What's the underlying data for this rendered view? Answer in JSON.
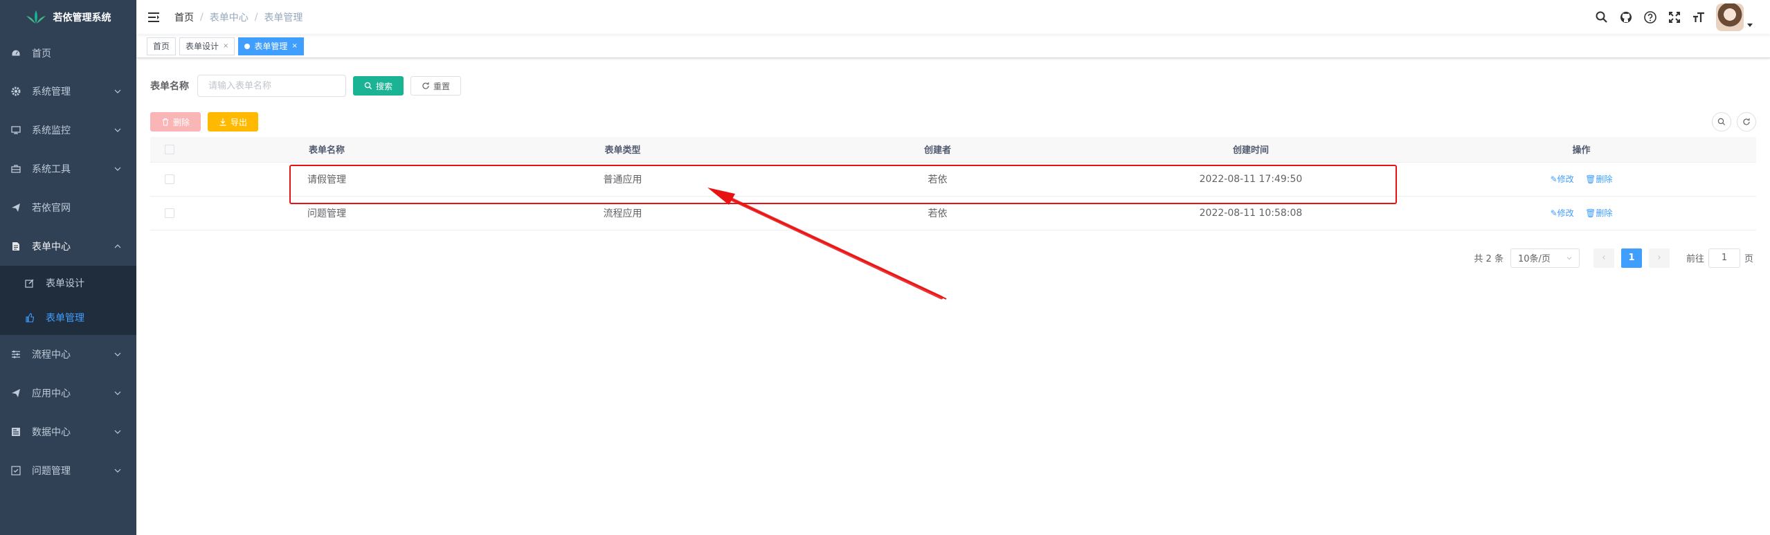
{
  "app": {
    "title": "若依管理系统"
  },
  "sidebar": {
    "items": [
      {
        "label": "首页",
        "icon": "dashboard-icon"
      },
      {
        "label": "系统管理",
        "icon": "gear-icon"
      },
      {
        "label": "系统监控",
        "icon": "monitor-icon"
      },
      {
        "label": "系统工具",
        "icon": "toolbox-icon"
      },
      {
        "label": "若依官网",
        "icon": "send-icon"
      },
      {
        "label": "表单中心",
        "icon": "form-icon"
      },
      {
        "label": "流程中心",
        "icon": "sliders-icon"
      },
      {
        "label": "应用中心",
        "icon": "send-icon"
      },
      {
        "label": "数据中心",
        "icon": "chart-icon"
      },
      {
        "label": "问题管理",
        "icon": "checkbox-icon"
      }
    ],
    "submenu": [
      {
        "label": "表单设计",
        "icon": "edit-icon"
      },
      {
        "label": "表单管理",
        "icon": "thumb-icon"
      }
    ]
  },
  "navbar": {
    "breadcrumb": [
      "首页",
      "表单中心",
      "表单管理"
    ],
    "separator": "/"
  },
  "tags": [
    {
      "label": "首页"
    },
    {
      "label": "表单设计",
      "close": "×"
    },
    {
      "label": "表单管理",
      "close": "×"
    }
  ],
  "search": {
    "label": "表单名称",
    "placeholder": "请输入表单名称",
    "search_button": "搜索",
    "reset_button": "重置"
  },
  "toolbar": {
    "delete_button": "删除",
    "export_button": "导出"
  },
  "table": {
    "columns": [
      "表单名称",
      "表单类型",
      "创建者",
      "创建时间",
      "操作"
    ],
    "rows": [
      {
        "name": "请假管理",
        "type": "普通应用",
        "creator": "若依",
        "time": "2022-08-11 17:49:50",
        "edit": "修改",
        "delete": "删除"
      },
      {
        "name": "问题管理",
        "type": "流程应用",
        "creator": "若依",
        "time": "2022-08-11 10:58:08",
        "edit": "修改",
        "delete": "删除"
      }
    ]
  },
  "pagination": {
    "total": "共 2 条",
    "page_size": "10条/页",
    "current_page": "1",
    "goto_label": "前往",
    "goto_value": "1",
    "page_unit": "页"
  },
  "colors": {
    "sidebar_bg": "#304156",
    "submenu_bg": "#1f2d3d",
    "accent": "#409eff",
    "primary_button": "#1ab394",
    "danger_button": "#fab6b6",
    "warning_button": "#ffba00",
    "annotation": "#e81212"
  }
}
